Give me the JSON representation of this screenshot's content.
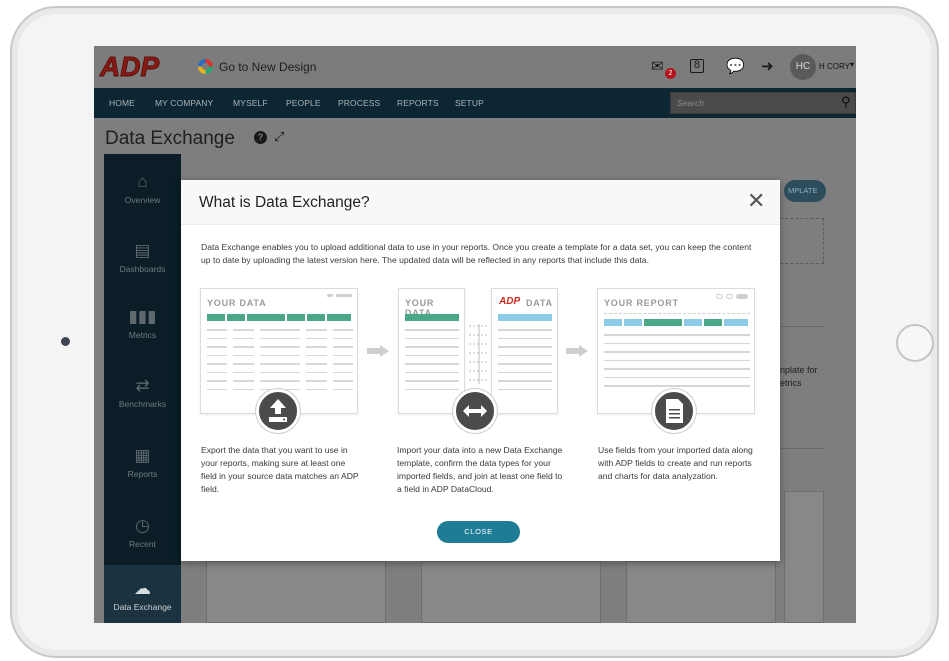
{
  "topbar": {
    "brand": "ADP",
    "new_design_label": "Go to New Design",
    "mail_badge": "2",
    "calendar_day": "8",
    "avatar_initials": "HC",
    "user_name": "H CORY"
  },
  "nav": {
    "items": [
      "HOME",
      "MY COMPANY",
      "MYSELF",
      "PEOPLE",
      "PROCESS",
      "REPORTS",
      "SETUP"
    ],
    "search_placeholder": "Search"
  },
  "page": {
    "title": "Data Exchange"
  },
  "sidebar": {
    "items": [
      {
        "label": "Overview",
        "icon": "home-icon"
      },
      {
        "label": "Dashboards",
        "icon": "dashboard-icon"
      },
      {
        "label": "Metrics",
        "icon": "bar-chart-icon"
      },
      {
        "label": "Benchmarks",
        "icon": "benchmark-icon"
      },
      {
        "label": "Reports",
        "icon": "report-icon"
      },
      {
        "label": "Recent",
        "icon": "clock-icon"
      },
      {
        "label": "Data Exchange",
        "icon": "cloud-upload-icon",
        "active": true
      }
    ]
  },
  "background": {
    "button_label": "MPLATE",
    "text_line1": "nplate for",
    "text_line2": "etrics"
  },
  "modal": {
    "title": "What is Data Exchange?",
    "description": "Data Exchange enables you to upload additional data to use in your reports. Once you create a template for a data set, you can keep the content up to date by uploading the latest version here. The updated data will be reflected in any reports that include this data.",
    "steps": [
      {
        "card_label": "YOUR DATA",
        "icon": "upload-icon",
        "text": "Export the data that you want to use in your reports, making sure at least one field in your source data matches an ADP field."
      },
      {
        "card_label": "YOUR DATA",
        "card_label_right": "DATA",
        "card_label_right_brand": "ADP",
        "icon": "exchange-arrows-icon",
        "text": "Import your data into a new Data Exchange template, confirm the data types for your imported fields, and join at least one field to a field in ADP DataCloud."
      },
      {
        "card_label": "YOUR REPORT",
        "icon": "document-icon",
        "text": "Use fields from your imported data along with ADP fields to create and run reports and charts for data analyzation."
      }
    ],
    "close_label": "CLOSE"
  },
  "colors": {
    "nav_bg": "#0c2633",
    "adp_red": "#d0271d",
    "green_header": "#4aa788",
    "blue_header": "#8ccbe8",
    "close_button": "#1f7c96"
  }
}
